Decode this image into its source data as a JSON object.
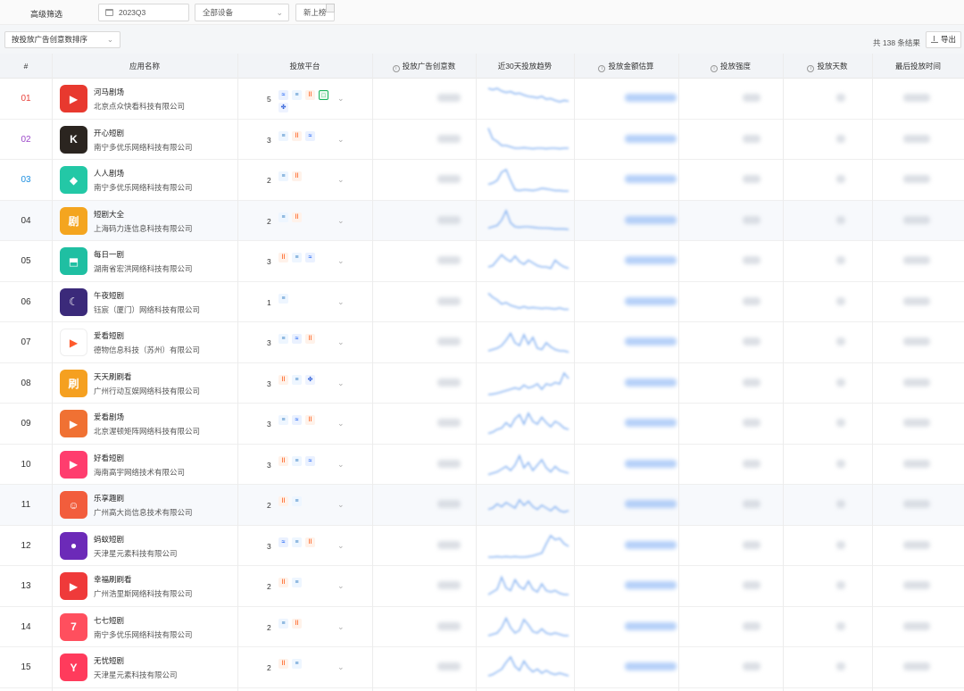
{
  "filters": {
    "label": "高级筛选",
    "date": "2023Q3",
    "device": "全部设备",
    "chart": "新上榜"
  },
  "toolbar": {
    "sort": "按投放广告创意数排序",
    "total": "共 138 条结果",
    "export": "导出"
  },
  "columns": {
    "rank": "#",
    "app": "应用名称",
    "platform": "投放平台",
    "creatives": "投放广告创意数",
    "trend": "近30天投放趋势",
    "amount": "投放金额估算",
    "intensity": "投放强度",
    "days": "投放天数",
    "last": "最后投放时间"
  },
  "rank_colors": {
    "01": "#e8433b",
    "02": "#9c48c9",
    "03": "#1d8fe0"
  },
  "rows": [
    {
      "rank": "01",
      "name": "河马剧场",
      "company": "北京点众快看科技有限公司",
      "count": "5",
      "icon_color": "#e8392f",
      "icon": "play-triangle-icon",
      "platforms": [
        "blue-wave",
        "blue-doc",
        "orange-bars",
        "green-box",
        "blue-paw"
      ],
      "trend": [
        0.9,
        0.85,
        0.9,
        0.8,
        0.75,
        0.78,
        0.7,
        0.72,
        0.65,
        0.6,
        0.58,
        0.55,
        0.6,
        0.5,
        0.52,
        0.45,
        0.4,
        0.45,
        0.42
      ]
    },
    {
      "rank": "02",
      "name": "开心短剧",
      "company": "南宁多优乐网络科技有限公司",
      "count": "3",
      "icon_color": "#2b2520",
      "icon": "k-logo-icon",
      "platforms": [
        "blue-doc",
        "orange-bars",
        "blue-wave"
      ],
      "trend": [
        0.95,
        0.55,
        0.45,
        0.3,
        0.3,
        0.25,
        0.2,
        0.2,
        0.22,
        0.2,
        0.18,
        0.2,
        0.2,
        0.18,
        0.2,
        0.2,
        0.18,
        0.2,
        0.2
      ]
    },
    {
      "rank": "03",
      "name": "人人剧场",
      "company": "南宁多优乐网络科技有限公司",
      "count": "2",
      "icon_color": "#23c8a6",
      "icon": "ticket-icon",
      "platforms": [
        "blue-doc",
        "orange-bars"
      ],
      "trend": [
        0.35,
        0.4,
        0.5,
        0.8,
        0.9,
        0.5,
        0.15,
        0.12,
        0.15,
        0.14,
        0.12,
        0.15,
        0.2,
        0.18,
        0.15,
        0.12,
        0.12,
        0.1,
        0.1
      ]
    },
    {
      "rank": "04",
      "name": "短剧大全",
      "company": "上海码力连信息科技有限公司",
      "count": "2",
      "icon_color": "#f4a51f",
      "icon": "film-icon",
      "platforms": [
        "blue-doc",
        "orange-bars"
      ],
      "trend": [
        0.25,
        0.3,
        0.35,
        0.55,
        0.9,
        0.45,
        0.3,
        0.28,
        0.3,
        0.3,
        0.28,
        0.26,
        0.25,
        0.25,
        0.24,
        0.22,
        0.22,
        0.22,
        0.2
      ]
    },
    {
      "rank": "05",
      "name": "每日一剧",
      "company": "湖南省宏洪网络科技有限公司",
      "count": "3",
      "icon_color": "#1fbfa2",
      "icon": "tv-icon",
      "platforms": [
        "orange-bars",
        "blue-doc",
        "blue-wave"
      ],
      "trend": [
        0.3,
        0.35,
        0.55,
        0.75,
        0.6,
        0.5,
        0.7,
        0.5,
        0.4,
        0.55,
        0.45,
        0.35,
        0.3,
        0.3,
        0.25,
        0.55,
        0.4,
        0.3,
        0.25
      ]
    },
    {
      "rank": "06",
      "name": "午夜短剧",
      "company": "钰宸（厦门）网络科技有限公司",
      "count": "1",
      "icon_color": "#3b2a7a",
      "icon": "moon-icon",
      "platforms": [
        "blue-doc"
      ],
      "trend": [
        0.85,
        0.7,
        0.6,
        0.45,
        0.5,
        0.4,
        0.35,
        0.3,
        0.35,
        0.3,
        0.32,
        0.3,
        0.28,
        0.3,
        0.28,
        0.26,
        0.3,
        0.25,
        0.25
      ]
    },
    {
      "rank": "07",
      "name": "爱看短剧",
      "company": "德物信息科技（苏州）有限公司",
      "count": "3",
      "icon_color": "#ffffff",
      "icon": "camera-icon",
      "platforms": [
        "blue-doc",
        "blue-wave",
        "orange-bars"
      ],
      "trend": [
        0.2,
        0.25,
        0.3,
        0.4,
        0.6,
        0.85,
        0.5,
        0.4,
        0.8,
        0.45,
        0.7,
        0.3,
        0.25,
        0.5,
        0.35,
        0.25,
        0.2,
        0.2,
        0.15
      ]
    },
    {
      "rank": "08",
      "name": "天天刷刷看",
      "company": "广州行动互娱网络科技有限公司",
      "count": "3",
      "icon_color": "#f5a020",
      "icon": "brush-icon",
      "platforms": [
        "orange-bars",
        "blue-doc",
        "blue-paw"
      ],
      "trend": [
        0.1,
        0.12,
        0.15,
        0.2,
        0.25,
        0.3,
        0.35,
        0.3,
        0.45,
        0.35,
        0.4,
        0.5,
        0.3,
        0.5,
        0.45,
        0.55,
        0.5,
        0.9,
        0.7
      ]
    },
    {
      "rank": "09",
      "name": "爱看剧场",
      "company": "北京渥顿矩阵网络科技有限公司",
      "count": "3",
      "icon_color": "#f07133",
      "icon": "play-icon",
      "platforms": [
        "blue-doc",
        "blue-wave",
        "orange-bars"
      ],
      "trend": [
        0.15,
        0.2,
        0.3,
        0.35,
        0.55,
        0.4,
        0.7,
        0.85,
        0.5,
        0.9,
        0.6,
        0.5,
        0.75,
        0.55,
        0.4,
        0.6,
        0.5,
        0.35,
        0.3
      ]
    },
    {
      "rank": "10",
      "name": "好看短剧",
      "company": "海南高宇网络技术有限公司",
      "count": "3",
      "icon_color": "#ff3d6e",
      "icon": "play-icon",
      "platforms": [
        "orange-bars",
        "blue-doc",
        "blue-wave"
      ],
      "trend": [
        0.15,
        0.2,
        0.25,
        0.35,
        0.45,
        0.3,
        0.5,
        0.85,
        0.4,
        0.6,
        0.3,
        0.5,
        0.7,
        0.4,
        0.25,
        0.45,
        0.3,
        0.25,
        0.2
      ]
    },
    {
      "rank": "11",
      "name": "乐享趣刷",
      "company": "广州高大尚信息技术有限公司",
      "count": "2",
      "icon_color": "#f25d3c",
      "icon": "smile-icon",
      "platforms": [
        "orange-bars",
        "blue-doc"
      ],
      "trend": [
        0.35,
        0.4,
        0.55,
        0.45,
        0.6,
        0.5,
        0.4,
        0.7,
        0.5,
        0.65,
        0.45,
        0.35,
        0.5,
        0.4,
        0.3,
        0.45,
        0.3,
        0.25,
        0.3
      ]
    },
    {
      "rank": "12",
      "name": "蚂蚁短剧",
      "company": "天津星元素科技有限公司",
      "count": "3",
      "icon_color": "#6c2ab8",
      "icon": "ant-icon",
      "platforms": [
        "blue-wave",
        "blue-doc",
        "orange-bars"
      ],
      "trend": [
        0.1,
        0.1,
        0.12,
        0.1,
        0.12,
        0.1,
        0.12,
        0.1,
        0.1,
        0.12,
        0.15,
        0.2,
        0.25,
        0.6,
        0.9,
        0.75,
        0.8,
        0.6,
        0.5
      ]
    },
    {
      "rank": "13",
      "name": "幸福刷刷看",
      "company": "广州浩里斯网络科技有限公司",
      "count": "2",
      "icon_color": "#ef3a3a",
      "icon": "play-icon",
      "platforms": [
        "orange-bars",
        "blue-doc"
      ],
      "trend": [
        0.2,
        0.3,
        0.4,
        0.85,
        0.45,
        0.35,
        0.75,
        0.5,
        0.4,
        0.7,
        0.4,
        0.3,
        0.6,
        0.35,
        0.3,
        0.35,
        0.25,
        0.2,
        0.2
      ]
    },
    {
      "rank": "14",
      "name": "七七短剧",
      "company": "南宁多优乐网络科技有限公司",
      "count": "2",
      "icon_color": "#ff4f5e",
      "icon": "seven-icon",
      "platforms": [
        "blue-doc",
        "orange-bars"
      ],
      "trend": [
        0.2,
        0.25,
        0.3,
        0.5,
        0.85,
        0.5,
        0.3,
        0.4,
        0.8,
        0.6,
        0.35,
        0.3,
        0.45,
        0.3,
        0.25,
        0.3,
        0.25,
        0.2,
        0.2
      ]
    },
    {
      "rank": "15",
      "name": "无忧短剧",
      "company": "天津星元素科技有限公司",
      "count": "2",
      "icon_color": "#ff3b5c",
      "icon": "yoyo-icon",
      "platforms": [
        "orange-bars",
        "blue-doc"
      ],
      "trend": [
        0.2,
        0.25,
        0.35,
        0.45,
        0.7,
        0.9,
        0.55,
        0.4,
        0.75,
        0.5,
        0.35,
        0.45,
        0.3,
        0.4,
        0.3,
        0.25,
        0.3,
        0.25,
        0.2
      ]
    }
  ]
}
